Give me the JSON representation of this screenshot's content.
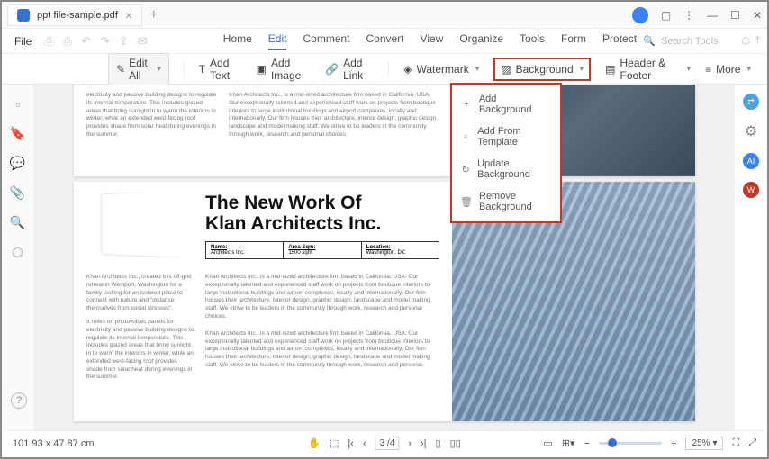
{
  "titlebar": {
    "tab_name": "ppt file-sample.pdf"
  },
  "menubar": {
    "file": "File",
    "tabs": [
      "Home",
      "Edit",
      "Comment",
      "Convert",
      "View",
      "Organize",
      "Tools",
      "Form",
      "Protect"
    ],
    "active_tab": "Edit",
    "search_placeholder": "Search Tools"
  },
  "ribbon": {
    "edit_all": "Edit All",
    "add_text": "Add Text",
    "add_image": "Add Image",
    "add_link": "Add Link",
    "watermark": "Watermark",
    "background": "Background",
    "header_footer": "Header & Footer",
    "more": "More"
  },
  "background_menu": {
    "items": [
      {
        "icon": "+",
        "label": "Add Background"
      },
      {
        "icon": "▫",
        "label": "Add From Template"
      },
      {
        "icon": "↻",
        "label": "Update Background"
      },
      {
        "icon": "🗑",
        "label": "Remove Background"
      }
    ]
  },
  "document": {
    "page1": {
      "col_a": "electricity and passive building designs to regulate its internal temperature. This includes glazed areas that bring sunlight in to warm the interiors in winter, while an extended west-facing roof provides shade from solar heat during evenings in the summer.",
      "col_b": "Khan Architects Inc., is a mid-sized architecture firm based in California, USA. Our exceptionally talented and experienced staff work on projects from boutique interiors to large institutional buildings and airport complexes, locally and internationally. Our firm houses their architecture, interior design, graphic design, landscape and model making staff. We strive to be leaders in the community through work, research and personal choices."
    },
    "page2": {
      "title_l1": "The New Work Of",
      "title_l2": "Klan Architects Inc.",
      "table": {
        "h1": "Name:",
        "v1": "Architects Inc.",
        "h2": "Area Sqm:",
        "v2": "1500 sqm",
        "h3": "Location:",
        "v3": "Washington, DC"
      },
      "left_a": "Khan Architects Inc., created this off-grid retreat in Westport, Washington for a family looking for an isolated place to connect with nature and \"distance themselves from social stresses\".",
      "left_b": "It relies on photovoltaic panels for electricity and passive building designs to regulate its internal temperature. This includes glazed areas that bring sunlight in to warm the interiors in winter, while an extended west-facing roof provides shade from solar heat during evenings in the summer.",
      "right_a": "Khan Architects Inc., is a mid-sized architecture firm based in California, USA. Our exceptionally talented and experienced staff work on projects from boutique interiors to large institutional buildings and airport complexes, locally and internationally. Our firm houses their architecture, interior design, graphic design, landscape and model making staff. We strive to be leaders in the community through work, research and personal choices.",
      "right_b": "Khan Architects Inc., is a mid-sized architecture firm based in California, USA. Our exceptionally talented and experienced staff work on projects from boutique interiors to large institutional buildings and airport complexes, locally and internationally. Our firm houses their architecture, interior design, graphic design, landscape and model making staff. We strive to be leaders in the community through work, research and personal."
    }
  },
  "status": {
    "coords": "101.93 x 47.87 cm",
    "page_current": "3",
    "page_total": "4",
    "zoom": "25%"
  }
}
